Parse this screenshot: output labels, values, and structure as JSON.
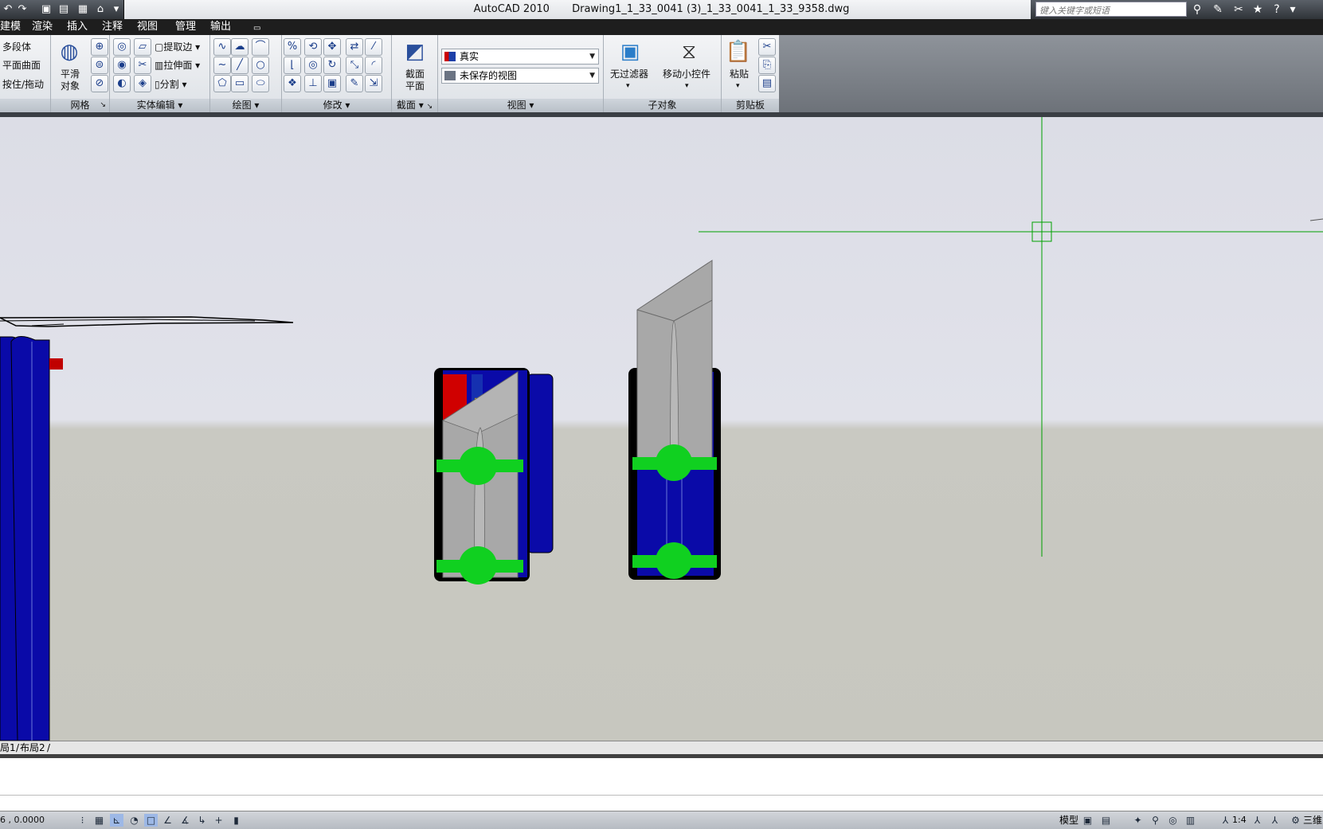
{
  "window": {
    "app_title": "AutoCAD 2010",
    "file_name": "Drawing1_1_33_0041 (3)_1_33_0041_1_33_9358.dwg",
    "search_placeholder": "键入关键字或短语"
  },
  "menu_tabs": [
    "建模",
    "渲染",
    "插入",
    "注释",
    "视图",
    "管理",
    "输出"
  ],
  "ribbon": {
    "modeling_items": [
      "多段体",
      "平面曲面",
      "按住/拖动"
    ],
    "mesh": {
      "smooth_label_1": "平滑",
      "smooth_label_2": "对象",
      "title": "网格"
    },
    "solid_edit": {
      "extract_edges": "提取边",
      "extrude_faces": "拉伸面",
      "separate": "分割",
      "title": "实体编辑"
    },
    "draw": {
      "title": "绘图"
    },
    "modify": {
      "title": "修改"
    },
    "section": {
      "label_1": "截面",
      "label_2": "平面",
      "title": "截面"
    },
    "view": {
      "visual_style": "真实",
      "saved_view": "未保存的视图",
      "title": "视图"
    },
    "subobject": {
      "no_filter": "无过滤器",
      "move_gizmo": "移动小控件",
      "title": "子对象"
    },
    "clipboard": {
      "paste": "粘贴",
      "title": "剪贴板"
    }
  },
  "layout_tabs": [
    "局1",
    "布局2"
  ],
  "status": {
    "coordinates": "6 , 0.0000",
    "model_label": "模型",
    "annotation_scale": "1:4",
    "workspace": "三维"
  },
  "colors": {
    "accent_blue": "#0a0aa8",
    "gizmo_green": "#10d020",
    "crosshair_green": "#00a000",
    "part_gray": "#a9a9a9"
  }
}
